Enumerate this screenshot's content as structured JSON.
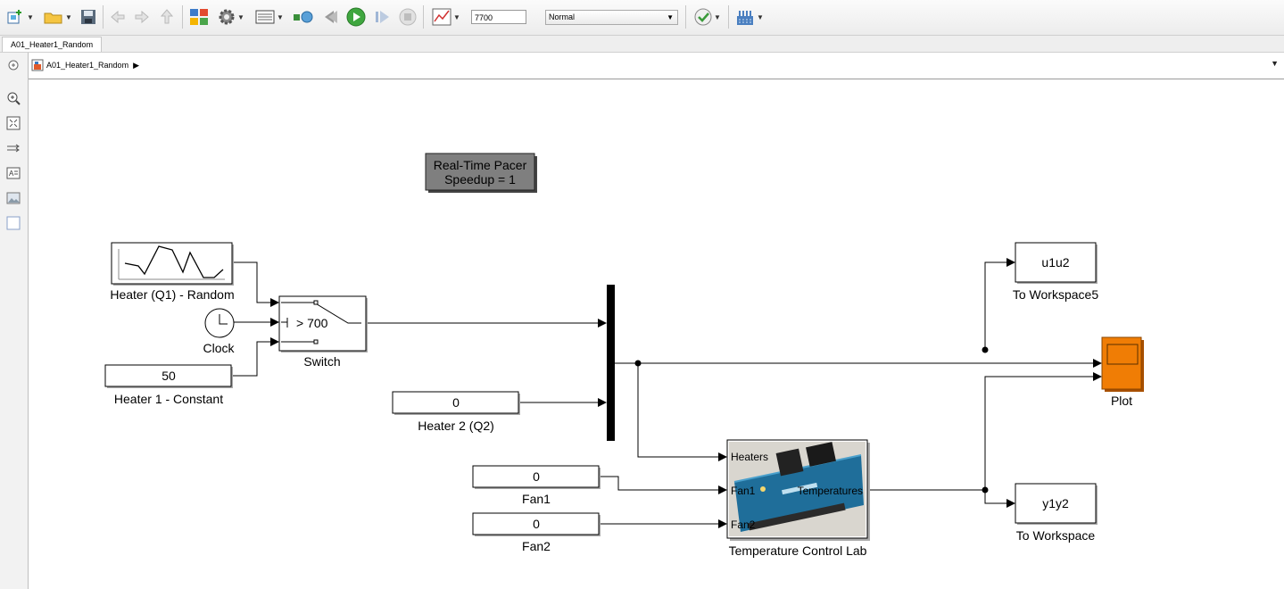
{
  "toolbar": {
    "stop_time": "7700",
    "sim_mode": "Normal"
  },
  "tabs": [
    "A01_Heater1_Random"
  ],
  "breadcrumb": {
    "model": "A01_Heater1_Random"
  },
  "blocks": {
    "pacer_line1": "Real-Time Pacer",
    "pacer_line2": "Speedup = 1",
    "random_label": "Heater (Q1) - Random",
    "clock_label": "Clock",
    "const50_value": "50",
    "const50_label": "Heater 1 - Constant",
    "switch_threshold": "> 700",
    "switch_label": "Switch",
    "heater2_value": "0",
    "heater2_label": "Heater 2 (Q2)",
    "fan1_value": "0",
    "fan1_label": "Fan1",
    "fan2_value": "0",
    "fan2_label": "Fan2",
    "tclab_in1": "Heaters",
    "tclab_in2": "Fan1",
    "tclab_in3": "Fan2",
    "tclab_out": "Temperatures",
    "tclab_label": "Temperature Control Lab",
    "ws5_value": "u1u2",
    "ws5_label": "To Workspace5",
    "ws_value": "y1y2",
    "ws_label": "To Workspace",
    "plot_label": "Plot"
  },
  "colors": {
    "scope": "#f07d05",
    "pacer": "#7f7f7f",
    "board": "#1f6e9a"
  }
}
